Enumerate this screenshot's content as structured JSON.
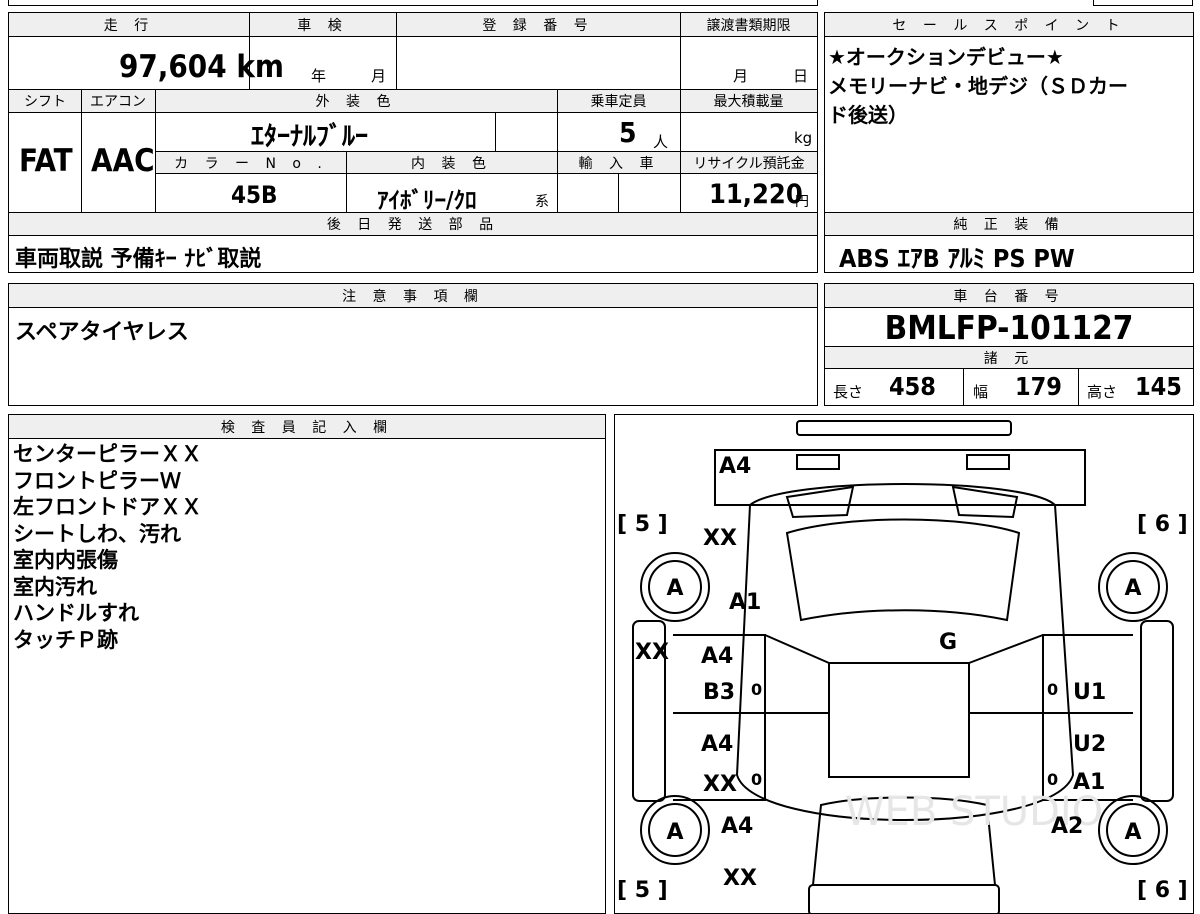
{
  "labels": {
    "mileage": "走 行",
    "inspection": "車 検",
    "registration": "登 録 番 号",
    "transfer_deadline": "譲渡書類期限",
    "sales_points": "セ ー ル ス ポ イ ン ト",
    "shift": "シフト",
    "aircon": "エアコン",
    "exterior_color": "外 装 色",
    "capacity": "乗車定員",
    "max_load": "最大積載量",
    "color_no": "カ ラ ー N o .",
    "interior_color": "内 装 色",
    "import": "輸 入 車",
    "recycle": "リサイクル預託金",
    "later_parts": "後 日 発 送 部 品",
    "standard_equipment": "純 正 装 備",
    "notes": "注 意 事 項 欄",
    "chassis": "車 台 番 号",
    "specs": "諸 元",
    "length": "長さ",
    "width": "幅",
    "height": "高さ",
    "inspector": "検 査 員 記 入 欄"
  },
  "values": {
    "mileage": "97,604 km",
    "inspection_year": "年",
    "inspection_month": "月",
    "transfer_month": "月",
    "transfer_day": "日",
    "shift": "FAT",
    "aircon": "AAC",
    "exterior_color": "ｴﾀｰﾅﾙﾌﾞﾙｰ",
    "capacity": "5",
    "capacity_unit": "人",
    "max_load_unit": "kg",
    "color_no": "45B",
    "interior_color": "ｱｲﾎﾞﾘｰ/ｸﾛ",
    "interior_suffix": "系",
    "recycle": "11,220",
    "recycle_unit": "円",
    "later_parts": "車両取説 予備ｷｰ ﾅﾋﾞ取説",
    "standard_equipment": "ABS ｴｱB ｱﾙﾐ PS PW",
    "notes": "スペアタイヤレス",
    "chassis": "BMLFP-101127",
    "length": "458",
    "width": "179",
    "height": "145"
  },
  "sales_points": [
    "★オークションデビュー★",
    "メモリーナビ・地デジ（ＳＤカー",
    "ド後送）"
  ],
  "inspector_notes": [
    "センターピラーＸＸ",
    "フロントピラーＷ",
    "左フロントドアＸＸ",
    "シートしわ、汚れ",
    "室内内張傷",
    "室内汚れ",
    "ハンドルすれ",
    "タッチＰ跡"
  ],
  "diagram": {
    "marks": {
      "front_bumper": "A4",
      "left_pillar": "XX",
      "left_fender": "A1",
      "roof": "G",
      "left_sill": "XX",
      "left_front_door_1": "A4",
      "left_front_door_2": "B3",
      "left_rear_door_1": "A4",
      "left_rear_door_2": "XX",
      "left_rear_fender": "A4",
      "rear_bottom": "XX",
      "right_front_door": "U1",
      "right_rear_door_1": "U2",
      "right_rear_door_2": "A1",
      "right_rear_fender": "A2"
    },
    "tires": [
      "A",
      "A",
      "A",
      "A"
    ],
    "tire_labels": {
      "fl": "[ 5 ]",
      "fr": "[ 6 ]",
      "rl": "[ 5 ]",
      "rr": "[ 6 ]"
    },
    "zero": "0",
    "watermark": "WEB STUDIO"
  }
}
